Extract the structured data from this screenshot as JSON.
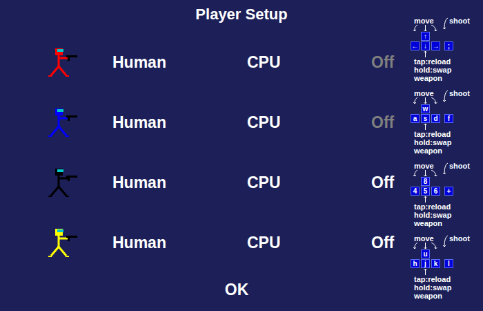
{
  "title": "Player Setup",
  "players": [
    {
      "color": "#ff0000",
      "options": [
        {
          "label": "Human",
          "disabled": false
        },
        {
          "label": "CPU",
          "disabled": false
        },
        {
          "label": "Off",
          "disabled": true
        }
      ],
      "controls": {
        "move": "move",
        "shoot": "shoot",
        "up": "↑",
        "left": "←",
        "down": "↓",
        "right": "→",
        "fire": ";",
        "hints": [
          "tap:reload",
          "hold:swap",
          "weapon"
        ]
      }
    },
    {
      "color": "#0000ff",
      "options": [
        {
          "label": "Human",
          "disabled": false
        },
        {
          "label": "CPU",
          "disabled": false
        },
        {
          "label": "Off",
          "disabled": true
        }
      ],
      "controls": {
        "move": "move",
        "shoot": "shoot",
        "up": "w",
        "left": "a",
        "down": "s",
        "right": "d",
        "fire": "f",
        "hints": [
          "tap:reload",
          "hold:swap",
          "weapon"
        ]
      }
    },
    {
      "color": "#000000",
      "options": [
        {
          "label": "Human",
          "disabled": false
        },
        {
          "label": "CPU",
          "disabled": false
        },
        {
          "label": "Off",
          "disabled": false
        }
      ],
      "controls": {
        "move": "move",
        "shoot": "shoot",
        "up": "8",
        "left": "4",
        "down": "5",
        "right": "6",
        "fire": "+",
        "hints": [
          "tap:reload",
          "hold:swap",
          "weapon"
        ]
      }
    },
    {
      "color": "#ffff00",
      "options": [
        {
          "label": "Human",
          "disabled": false
        },
        {
          "label": "CPU",
          "disabled": false
        },
        {
          "label": "Off",
          "disabled": false
        }
      ],
      "controls": {
        "move": "move",
        "shoot": "shoot",
        "up": "u",
        "left": "h",
        "down": "j",
        "right": "k",
        "fire": "l",
        "hints": [
          "tap:reload",
          "hold:swap",
          "weapon"
        ]
      }
    }
  ],
  "buttons": [
    "OK"
  ]
}
